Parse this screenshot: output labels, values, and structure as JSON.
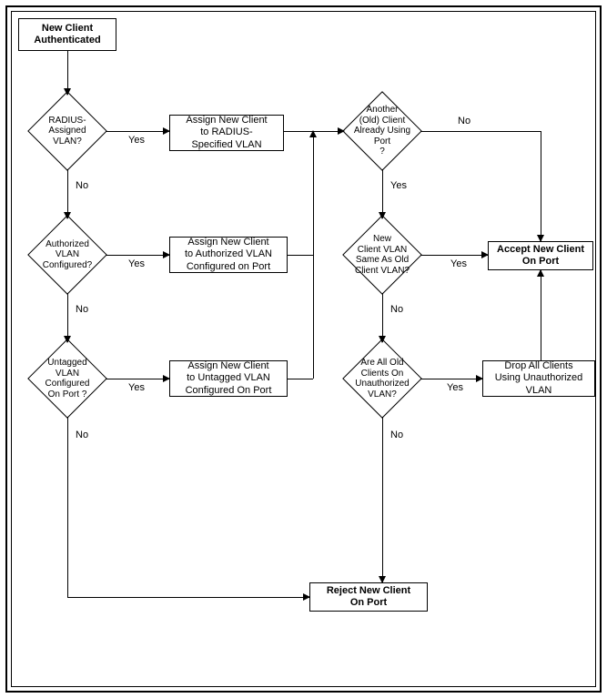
{
  "diagram": {
    "start": "New Client\nAuthenticated",
    "d1": "RADIUS-\nAssigned\nVLAN?",
    "d2": "Authorized\nVLAN\nConfigured?",
    "d3": "Untagged\nVLAN\nConfigured\nOn Port ?",
    "p1": "Assign New Client\nto RADIUS-\nSpecified VLAN",
    "p2": "Assign New Client\nto Authorized VLAN\nConfigured on Port",
    "p3": "Assign New Client\nto Untagged VLAN\nConfigured On Port",
    "d4": "Another\n(Old) Client\nAlready Using\nPort\n?",
    "d5": "New\nClient VLAN\nSame As Old\nClient VLAN?",
    "d6": "Are All Old\nClients On\nUnauthorized\nVLAN?",
    "accept": "Accept New Client\nOn Port",
    "drop": "Drop All Clients\nUsing Unauthorized\nVLAN",
    "reject": "Reject New Client\nOn Port",
    "yes": "Yes",
    "no": "No"
  },
  "chart_data": {
    "type": "flowchart",
    "nodes": [
      {
        "id": "start",
        "kind": "terminal",
        "label": "New Client Authenticated"
      },
      {
        "id": "d1",
        "kind": "decision",
        "label": "RADIUS-Assigned VLAN?"
      },
      {
        "id": "d2",
        "kind": "decision",
        "label": "Authorized VLAN Configured?"
      },
      {
        "id": "d3",
        "kind": "decision",
        "label": "Untagged VLAN Configured On Port ?"
      },
      {
        "id": "p1",
        "kind": "process",
        "label": "Assign New Client to RADIUS-Specified VLAN"
      },
      {
        "id": "p2",
        "kind": "process",
        "label": "Assign New Client to Authorized VLAN Configured on Port"
      },
      {
        "id": "p3",
        "kind": "process",
        "label": "Assign New Client to Untagged VLAN Configured On Port"
      },
      {
        "id": "d4",
        "kind": "decision",
        "label": "Another (Old) Client Already Using Port ?"
      },
      {
        "id": "d5",
        "kind": "decision",
        "label": "New Client VLAN Same As Old Client VLAN?"
      },
      {
        "id": "d6",
        "kind": "decision",
        "label": "Are All Old Clients On Unauthorized VLAN?"
      },
      {
        "id": "accept",
        "kind": "terminal",
        "label": "Accept New Client On Port"
      },
      {
        "id": "drop",
        "kind": "process",
        "label": "Drop All Clients Using Unauthorized VLAN"
      },
      {
        "id": "reject",
        "kind": "terminal",
        "label": "Reject New Client On Port"
      }
    ],
    "edges": [
      {
        "from": "start",
        "to": "d1"
      },
      {
        "from": "d1",
        "to": "p1",
        "label": "Yes"
      },
      {
        "from": "d1",
        "to": "d2",
        "label": "No"
      },
      {
        "from": "d2",
        "to": "p2",
        "label": "Yes"
      },
      {
        "from": "d2",
        "to": "d3",
        "label": "No"
      },
      {
        "from": "d3",
        "to": "p3",
        "label": "Yes"
      },
      {
        "from": "d3",
        "to": "reject",
        "label": "No"
      },
      {
        "from": "p1",
        "to": "d4"
      },
      {
        "from": "p2",
        "to": "d4"
      },
      {
        "from": "p3",
        "to": "d4"
      },
      {
        "from": "d4",
        "to": "accept",
        "label": "No"
      },
      {
        "from": "d4",
        "to": "d5",
        "label": "Yes"
      },
      {
        "from": "d5",
        "to": "accept",
        "label": "Yes"
      },
      {
        "from": "d5",
        "to": "d6",
        "label": "No"
      },
      {
        "from": "d6",
        "to": "drop",
        "label": "Yes"
      },
      {
        "from": "d6",
        "to": "reject",
        "label": "No"
      },
      {
        "from": "drop",
        "to": "accept"
      }
    ]
  }
}
